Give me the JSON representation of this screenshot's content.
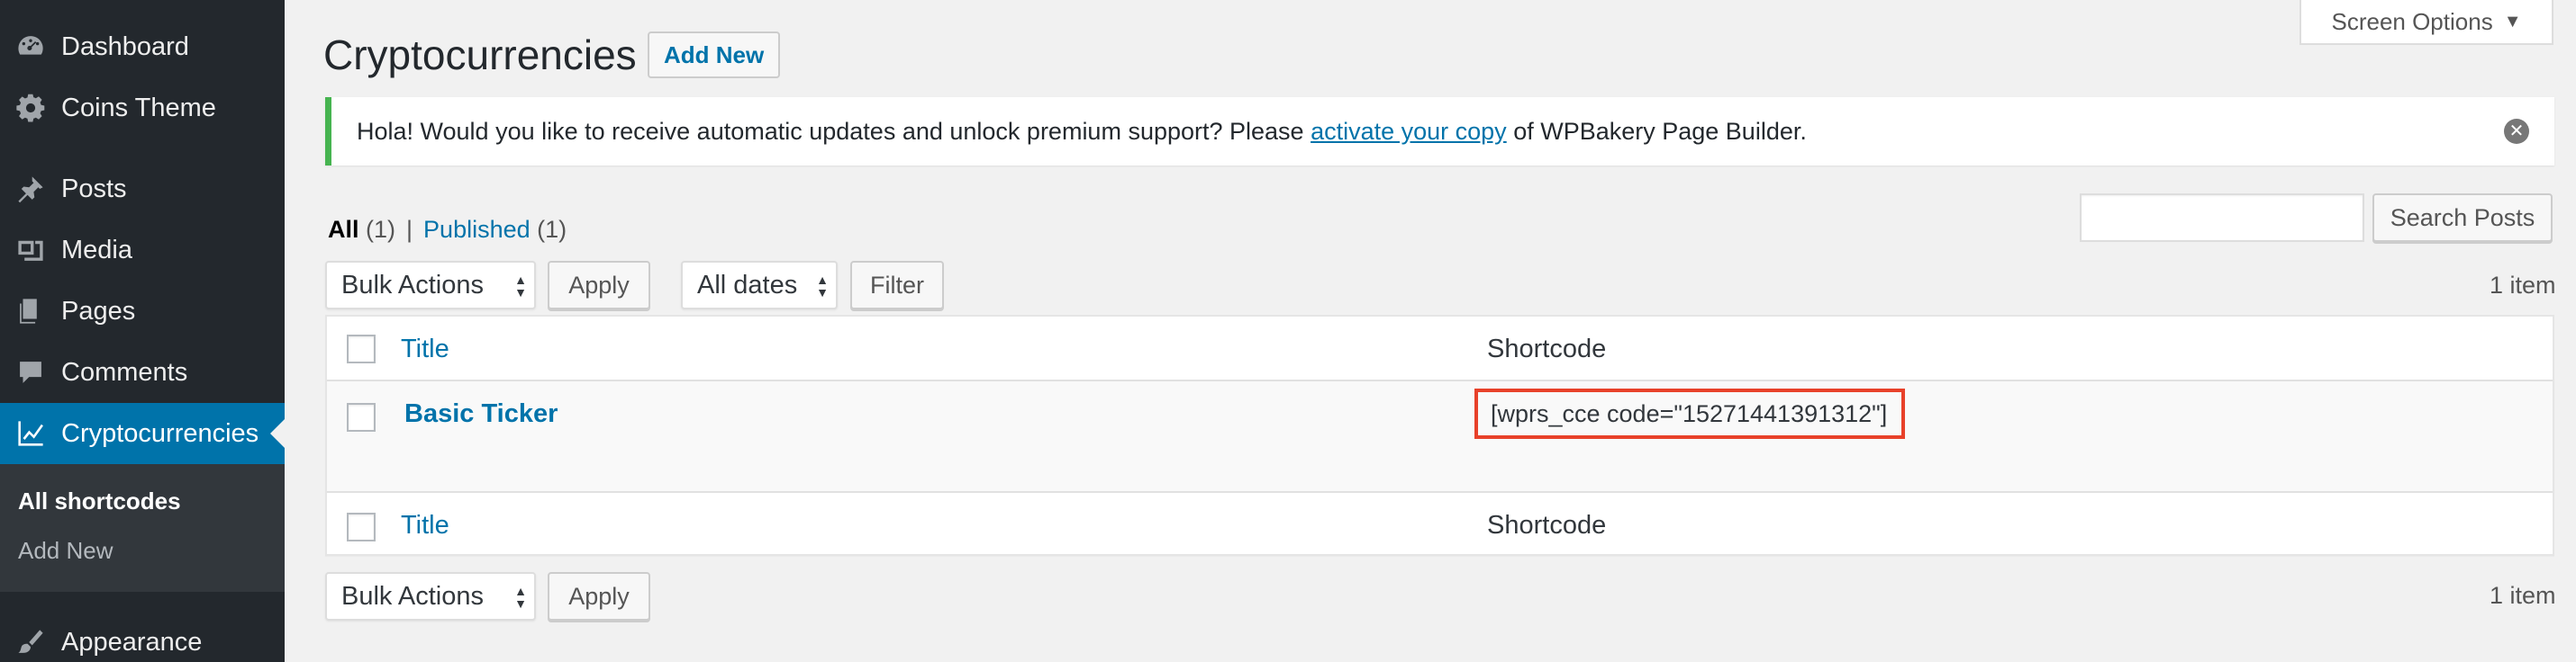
{
  "sidebar": {
    "items": [
      {
        "label": "Dashboard",
        "icon": "dashboard-icon"
      },
      {
        "label": "Coins Theme",
        "icon": "gear-icon"
      },
      {
        "label": "Posts",
        "icon": "pushpin-icon"
      },
      {
        "label": "Media",
        "icon": "media-icon"
      },
      {
        "label": "Pages",
        "icon": "pages-icon"
      },
      {
        "label": "Comments",
        "icon": "comment-icon"
      },
      {
        "label": "Cryptocurrencies",
        "icon": "chart-line-icon",
        "active": true
      },
      {
        "label": "Appearance",
        "icon": "paintbrush-icon"
      }
    ],
    "submenu": [
      {
        "label": "All shortcodes",
        "current": true
      },
      {
        "label": "Add New"
      }
    ]
  },
  "screen_options": {
    "label": "Screen Options"
  },
  "page": {
    "title": "Cryptocurrencies",
    "add_new_label": "Add New"
  },
  "notice": {
    "text_before": "Hola! Would you like to receive automatic updates and unlock premium support? Please ",
    "link_text": "activate your copy",
    "text_after": " of WPBakery Page Builder."
  },
  "views": {
    "all_label": "All",
    "all_count": "(1)",
    "separator": "|",
    "published_label": "Published",
    "published_count": "(1)"
  },
  "search": {
    "value": "",
    "button_label": "Search Posts"
  },
  "top_nav": {
    "bulk_actions": "Bulk Actions",
    "apply": "Apply",
    "dates": "All dates",
    "filter": "Filter",
    "count": "1 item"
  },
  "table": {
    "columns": {
      "title": "Title",
      "shortcode": "Shortcode"
    },
    "rows": [
      {
        "title": "Basic Ticker",
        "shortcode": "[wprs_cce code=\"15271441391312\"]"
      }
    ]
  },
  "bottom_nav": {
    "bulk_actions": "Bulk Actions",
    "apply": "Apply",
    "count": "1 item"
  },
  "colors": {
    "sidebar_bg": "#23282d",
    "active_bg": "#0073aa",
    "link": "#0073aa",
    "notice_border": "#46b450",
    "highlight": "#e8412a"
  }
}
